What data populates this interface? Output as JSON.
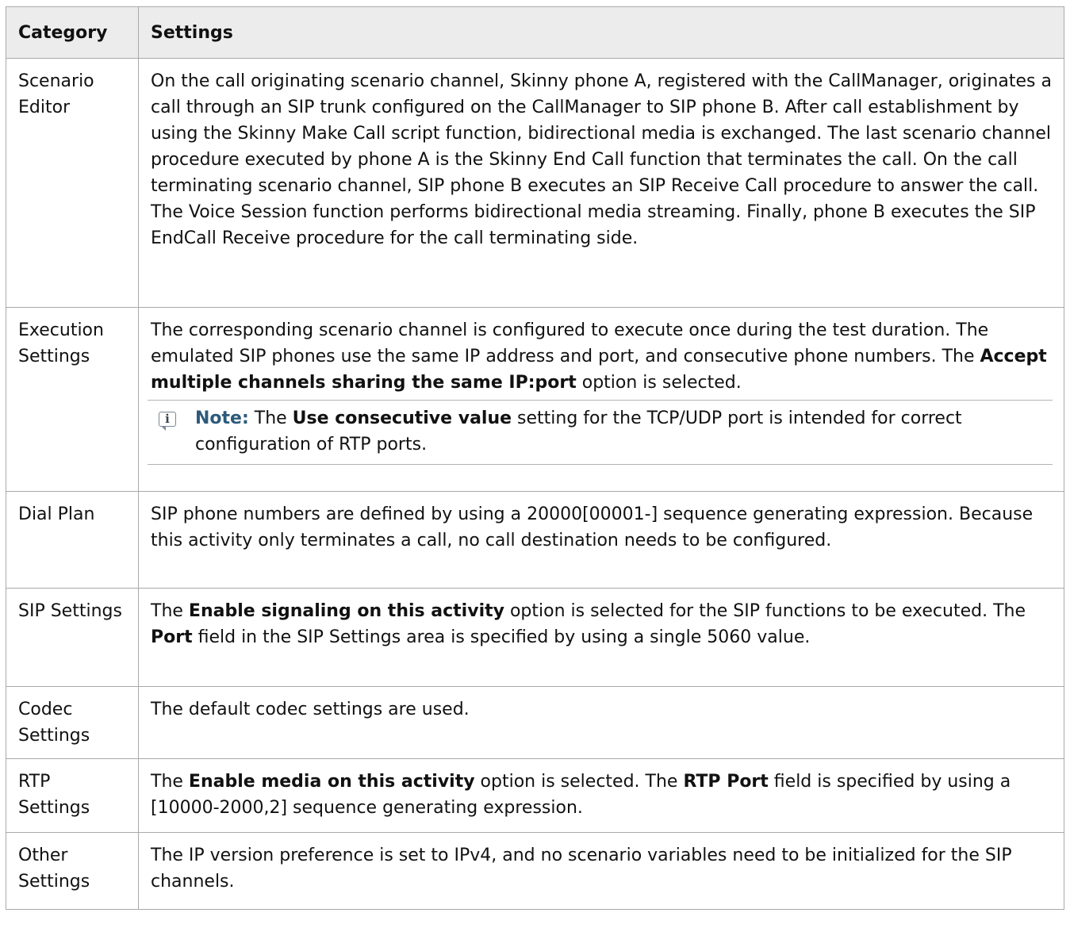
{
  "header": {
    "category": "Category",
    "settings": "Settings"
  },
  "rows": [
    {
      "category": "Scenario Editor",
      "text": "On the call originating scenario channel, Skinny phone A, registered with the CallManager, originates a call through an SIP trunk configured on the CallManager to SIP phone B. After call establishment by using the Skinny Make Call script function, bidirectional media is exchanged. The last scenario channel procedure executed by phone A is the Skinny End Call function that terminates the call. On the call terminating scenario channel, SIP phone B executes an SIP Receive Call procedure to answer the call. The Voice Session function performs bidirectional media streaming. Finally, phone B executes the SIP EndCall Receive procedure for the call terminating side."
    },
    {
      "category": "Execution Settings",
      "text_1": "The corresponding scenario channel is configured to execute once during the test duration. The emulated SIP phones use the same IP address and port, and consecutive phone numbers. The ",
      "bold_1": "Accept multiple channels sharing the same IP:port",
      "text_2": " option is selected.",
      "note": {
        "icon": "info-note-icon",
        "label": "Note:",
        "text_1": " The ",
        "bold_1": "Use consecutive value",
        "text_2": " setting for the TCP/UDP port is intended for correct configuration of RTP ports."
      }
    },
    {
      "category": "Dial Plan",
      "text": "SIP phone numbers are defined by using a 20000[00001-] sequence generating expression. Because this activity only terminates a call, no call destination needs to be configured."
    },
    {
      "category": "SIP Settings",
      "text_1": "The ",
      "bold_1": "Enable signaling on this activity",
      "text_2": " option is selected for the SIP functions to be executed. The ",
      "bold_2": "Port",
      "text_3": " field in the SIP Settings area is specified by using a single 5060 value."
    },
    {
      "category": "Codec Settings",
      "text": "The default codec settings are used."
    },
    {
      "category": "RTP Settings",
      "text_1": "The ",
      "bold_1": "Enable media on this activity",
      "text_2": " option is selected. The ",
      "bold_2": "RTP Port",
      "text_3": " field is specified by using a [10000-2000,2] sequence generating expression."
    },
    {
      "category": "Other Settings",
      "text": "The IP version preference is set to IPv4, and no scenario variables need to be initialized for the SIP channels."
    }
  ]
}
